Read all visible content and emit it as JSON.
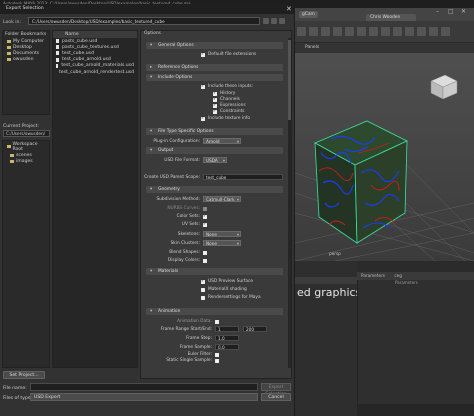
{
  "background": {
    "title_bar": "Autodesk MAYA 2023: C:/Users/owusden/Desktop/USD/examples/basic_textured_cube.ma",
    "maya_menubar": {
      "items": [
        "gCam",
        "Chris Wooden"
      ]
    },
    "panels_label": "Panels",
    "viewport_label": "persp",
    "overlay_text": "ed graphics",
    "attr_panel": {
      "header": "Parameters",
      "value": "ceg",
      "sub": "Parameters"
    }
  },
  "dialog": {
    "title": "Export Selection",
    "close": "✕",
    "look_in_label": "Look in:",
    "look_in_path": "C:/Users/owusden/Desktop/USD/examples/basic_textured_cube",
    "bookmarks_header": "Folder Bookmarks",
    "bookmarks": [
      "My Computer",
      "Desktop",
      "Documents",
      "owusden"
    ],
    "current_project_label": "Current Project:",
    "current_project": "C:/Users/owusden/",
    "project_tree": [
      "Workspace Root",
      "scenes",
      "images"
    ],
    "set_project_button": "Set Project...",
    "files_header": "Name",
    "files": [
      "pasts_cube.usd",
      "pasts_cube_textures.usd",
      "test_cube.usd",
      "test_cube_arnold.usd",
      "test_cube_arnold_materials.usd",
      "test_cube_arnold_rendertest.usd"
    ],
    "options_title": "Options",
    "sections": {
      "general": "General Options",
      "default_file_ext": "Default file extensions",
      "reference": "Reference Options",
      "include": "Include Options",
      "include_items": {
        "make_imports": "Include these inputs:",
        "history": "History",
        "channels": "Channels",
        "expressions": "Expressions",
        "constraints": "Constraints",
        "texture_info": "Include texture info"
      },
      "file_type": "File Type Specific Options",
      "plugin_label": "Plug-in Configuration:",
      "plugin_value": "Arnold",
      "output": "Output",
      "file_format_label": "USD File Format:",
      "file_format_value": "USDA",
      "parent_scope_label": "Create USD Parent Scope:",
      "parent_scope_value": "test_cube",
      "geometry": "Geometry",
      "subdiv_label": "Subdivision Method:",
      "subdiv_value": "Catmull-Clark",
      "normals_label": "NURBS Curves:",
      "color_sets_label": "Color Sets:",
      "uv_sets_label": "UV Sets:",
      "skeletons_label": "Skeletons:",
      "skeletons_value": "None",
      "skin_clusters_label": "Skin Clusters:",
      "skin_clusters_value": "None",
      "blend_shapes_label": "Blend Shapes:",
      "display_colors_label": "Display Colors:",
      "materials": "Materials",
      "usd_preview_surface": "USD Preview Surface",
      "materialx_shading": "MaterialX shading",
      "rendersettings": "Rendersettings for Maya",
      "animation": "Animation",
      "animation_data_label": "Animation Data:",
      "frame_range_label": "Frame Range Start/End:",
      "frame_range_start": "1",
      "frame_range_end": "200",
      "frame_step_label": "Frame Step:",
      "frame_step_value": "1.0",
      "frame_sample_label": "Frame Sample:",
      "frame_sample_value": "0.0",
      "euler_filter_label": "Euler Filter:",
      "static_single_label": "Static Single Sample:"
    },
    "file_name_label": "File name:",
    "file_name_value": "",
    "files_of_type_label": "Files of type:",
    "files_of_type_value": "USD Export",
    "export_button": "Export Selection",
    "cancel_button": "Cancel"
  }
}
